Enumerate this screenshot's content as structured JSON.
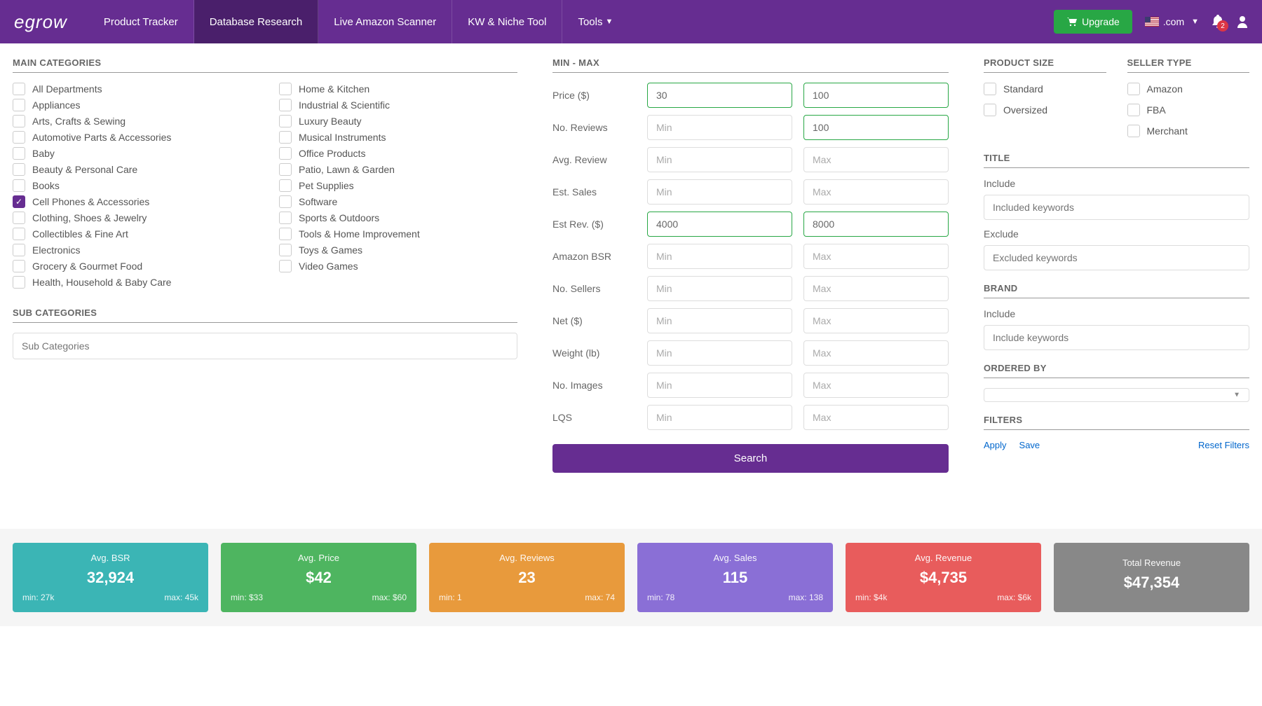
{
  "navbar": {
    "logo": "egrow",
    "tabs": [
      "Product Tracker",
      "Database Research",
      "Live Amazon Scanner",
      "KW & Niche Tool",
      "Tools"
    ],
    "activeTab": 1,
    "upgrade": "Upgrade",
    "region": ".com",
    "notifCount": "2"
  },
  "categories": {
    "title": "MAIN CATEGORIES",
    "col1": [
      {
        "label": "All Departments",
        "checked": false
      },
      {
        "label": "Appliances",
        "checked": false
      },
      {
        "label": "Arts, Crafts & Sewing",
        "checked": false
      },
      {
        "label": "Automotive Parts & Accessories",
        "checked": false
      },
      {
        "label": "Baby",
        "checked": false
      },
      {
        "label": "Beauty & Personal Care",
        "checked": false
      },
      {
        "label": "Books",
        "checked": false
      },
      {
        "label": "Cell Phones & Accessories",
        "checked": true
      },
      {
        "label": "Clothing, Shoes & Jewelry",
        "checked": false
      },
      {
        "label": "Collectibles & Fine Art",
        "checked": false
      },
      {
        "label": "Electronics",
        "checked": false
      },
      {
        "label": "Grocery & Gourmet Food",
        "checked": false
      },
      {
        "label": "Health, Household & Baby Care",
        "checked": false
      }
    ],
    "col2": [
      {
        "label": "Home & Kitchen",
        "checked": false
      },
      {
        "label": "Industrial & Scientific",
        "checked": false
      },
      {
        "label": "Luxury Beauty",
        "checked": false
      },
      {
        "label": "Musical Instruments",
        "checked": false
      },
      {
        "label": "Office Products",
        "checked": false
      },
      {
        "label": "Patio, Lawn & Garden",
        "checked": false
      },
      {
        "label": "Pet Supplies",
        "checked": false
      },
      {
        "label": "Software",
        "checked": false
      },
      {
        "label": "Sports & Outdoors",
        "checked": false
      },
      {
        "label": "Tools & Home Improvement",
        "checked": false
      },
      {
        "label": "Toys & Games",
        "checked": false
      },
      {
        "label": "Video Games",
        "checked": false
      }
    ]
  },
  "subcats": {
    "title": "SUB CATEGORIES",
    "placeholder": "Sub Categories"
  },
  "minmax": {
    "title": "MIN - MAX",
    "rows": [
      {
        "label": "Price ($)",
        "min": "30",
        "max": "100"
      },
      {
        "label": "No. Reviews",
        "min": "",
        "max": "100"
      },
      {
        "label": "Avg. Review",
        "min": "",
        "max": ""
      },
      {
        "label": "Est. Sales",
        "min": "",
        "max": ""
      },
      {
        "label": "Est Rev. ($)",
        "min": "4000",
        "max": "8000"
      },
      {
        "label": "Amazon BSR",
        "min": "",
        "max": ""
      },
      {
        "label": "No. Sellers",
        "min": "",
        "max": ""
      },
      {
        "label": "Net ($)",
        "min": "",
        "max": ""
      },
      {
        "label": "Weight (lb)",
        "min": "",
        "max": ""
      },
      {
        "label": "No. Images",
        "min": "",
        "max": ""
      },
      {
        "label": "LQS",
        "min": "",
        "max": ""
      }
    ],
    "minPlaceholder": "Min",
    "maxPlaceholder": "Max",
    "searchBtn": "Search"
  },
  "productSize": {
    "title": "PRODUCT SIZE",
    "options": [
      {
        "label": "Standard",
        "checked": false
      },
      {
        "label": "Oversized",
        "checked": false
      }
    ]
  },
  "sellerType": {
    "title": "SELLER TYPE",
    "options": [
      {
        "label": "Amazon",
        "checked": false
      },
      {
        "label": "FBA",
        "checked": false
      },
      {
        "label": "Merchant",
        "checked": false
      }
    ]
  },
  "titleFilter": {
    "title": "TITLE",
    "includeLabel": "Include",
    "includePlaceholder": "Included keywords",
    "excludeLabel": "Exclude",
    "excludePlaceholder": "Excluded keywords"
  },
  "brandFilter": {
    "title": "BRAND",
    "includeLabel": "Include",
    "includePlaceholder": "Include keywords"
  },
  "orderedBy": {
    "title": "ORDERED BY"
  },
  "filters": {
    "title": "FILTERS",
    "apply": "Apply",
    "save": "Save",
    "reset": "Reset Filters"
  },
  "stats": [
    {
      "title": "Avg. BSR",
      "value": "32,924",
      "min": "min: 27k",
      "max": "max: 45k",
      "color": "teal"
    },
    {
      "title": "Avg. Price",
      "value": "$42",
      "min": "min: $33",
      "max": "max: $60",
      "color": "green"
    },
    {
      "title": "Avg. Reviews",
      "value": "23",
      "min": "min: 1",
      "max": "max: 74",
      "color": "orange"
    },
    {
      "title": "Avg. Sales",
      "value": "115",
      "min": "min: 78",
      "max": "max: 138",
      "color": "purple"
    },
    {
      "title": "Avg. Revenue",
      "value": "$4,735",
      "min": "min: $4k",
      "max": "max: $6k",
      "color": "red"
    },
    {
      "title": "Total Revenue",
      "value": "$47,354",
      "min": "",
      "max": "",
      "color": "gray"
    }
  ]
}
